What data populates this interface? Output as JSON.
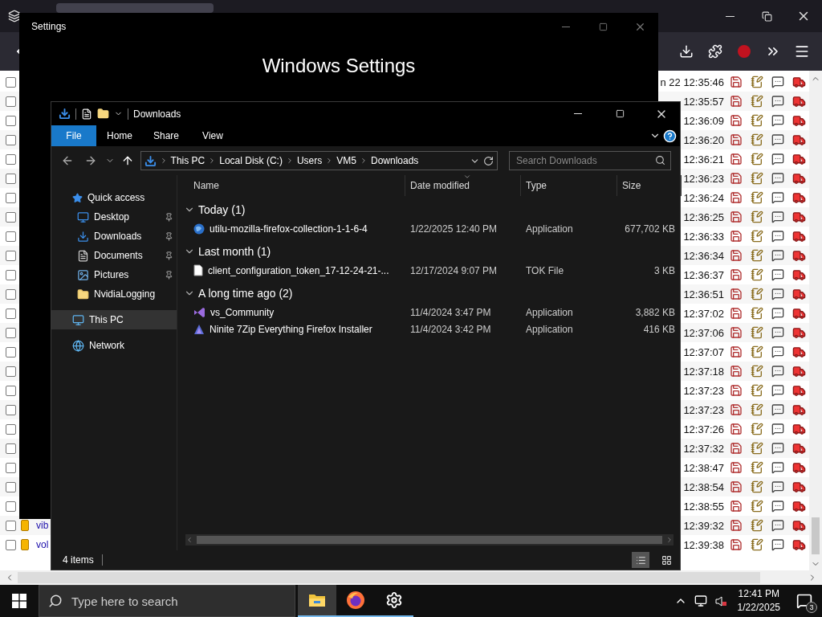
{
  "browser": {
    "rows": [
      {
        "checked": false,
        "time": "n 22 12:35:46"
      },
      {
        "checked": false,
        "time": "12:35:57"
      },
      {
        "checked": false,
        "time": "12:36:09"
      },
      {
        "checked": false,
        "time": "12:36:20"
      },
      {
        "checked": false,
        "time": "12:36:21"
      },
      {
        "checked": false,
        "time": "12:36:23"
      },
      {
        "checked": false,
        "time": "12:36:24"
      },
      {
        "checked": false,
        "time": "12:36:25"
      },
      {
        "checked": false,
        "time": "12:36:33"
      },
      {
        "checked": false,
        "time": "12:36:34"
      },
      {
        "checked": false,
        "time": "12:36:37"
      },
      {
        "checked": false,
        "time": "12:36:51"
      },
      {
        "checked": false,
        "time": "12:37:02"
      },
      {
        "checked": false,
        "time": "12:37:06"
      },
      {
        "checked": false,
        "time": "12:37:07"
      },
      {
        "checked": false,
        "time": "12:37:18"
      },
      {
        "checked": false,
        "time": "12:37:23"
      },
      {
        "checked": false,
        "time": "12:37:23"
      },
      {
        "checked": false,
        "time": "12:37:26"
      },
      {
        "checked": false,
        "time": "12:37:32"
      },
      {
        "checked": false,
        "time": "12:38:47"
      },
      {
        "checked": false,
        "time": "12:38:54"
      },
      {
        "checked": false,
        "time": "12:38:55"
      },
      {
        "checked": false,
        "link": "vib",
        "time": "12:39:32"
      },
      {
        "checked": false,
        "link": "vol",
        "time": "12:39:38"
      }
    ]
  },
  "settings_window": {
    "title": "Settings",
    "heading": "Windows Settings"
  },
  "explorer": {
    "title": "Downloads",
    "ribbon_tabs": [
      {
        "label": "File",
        "selected": true
      },
      {
        "label": "Home",
        "selected": false
      },
      {
        "label": "Share",
        "selected": false
      },
      {
        "label": "View",
        "selected": false
      }
    ],
    "breadcrumbs": [
      "This PC",
      "Local Disk (C:)",
      "Users",
      "VM5",
      "Downloads"
    ],
    "search": {
      "placeholder": "Search Downloads"
    },
    "nav": [
      {
        "label": "Quick access",
        "kind": "star",
        "selected": false,
        "children": [
          {
            "label": "Desktop",
            "kind": "desktop",
            "pinned": true,
            "selected": false
          },
          {
            "label": "Downloads",
            "kind": "download",
            "pinned": true,
            "selected": false
          },
          {
            "label": "Documents",
            "kind": "documents",
            "pinned": true,
            "selected": false
          },
          {
            "label": "Pictures",
            "kind": "pictures",
            "pinned": true,
            "selected": false
          },
          {
            "label": "NvidiaLogging",
            "kind": "folder",
            "pinned": false,
            "selected": false
          }
        ]
      },
      {
        "label": "This PC",
        "kind": "pc",
        "selected": true
      },
      {
        "label": "Network",
        "kind": "network",
        "selected": false
      }
    ],
    "columns": [
      {
        "label": "Name",
        "sorted": false
      },
      {
        "label": "Date modified",
        "sorted": true
      },
      {
        "label": "Type",
        "sorted": false
      },
      {
        "label": "Size",
        "sorted": false
      }
    ],
    "groups": [
      {
        "label": "Today (1)",
        "expanded": true,
        "items": [
          {
            "name": "utilu-mozilla-firefox-collection-1-1-6-4",
            "date": "1/22/2025 12:40 PM",
            "type": "Application",
            "size": "677,702 KB",
            "kind": "globe"
          }
        ]
      },
      {
        "label": "Last month (1)",
        "expanded": true,
        "items": [
          {
            "name": "client_configuration_token_17-12-24-21-...",
            "date": "12/17/2024 9:07 PM",
            "type": "TOK File",
            "size": "3 KB",
            "kind": "document"
          }
        ]
      },
      {
        "label": "A long time ago (2)",
        "expanded": true,
        "items": [
          {
            "name": "vs_Community",
            "date": "11/4/2024 3:47 PM",
            "type": "Application",
            "size": "3,882 KB",
            "kind": "vs"
          },
          {
            "name": "Ninite 7Zip Everything Firefox Installer",
            "date": "11/4/2024 3:42 PM",
            "type": "Application",
            "size": "416 KB",
            "kind": "ninite"
          }
        ]
      }
    ],
    "status": "4 items",
    "views": [
      {
        "kind": "details",
        "selected": true
      },
      {
        "kind": "tiles",
        "selected": false
      }
    ]
  },
  "taskbar": {
    "search_placeholder": "Type here to search",
    "apps": [
      {
        "kind": "explorer",
        "selected": true
      },
      {
        "kind": "firefox",
        "selected": false
      },
      {
        "kind": "settings",
        "selected": false
      }
    ],
    "time": "12:41 PM",
    "date": "1/22/2025",
    "notifications": "3"
  }
}
